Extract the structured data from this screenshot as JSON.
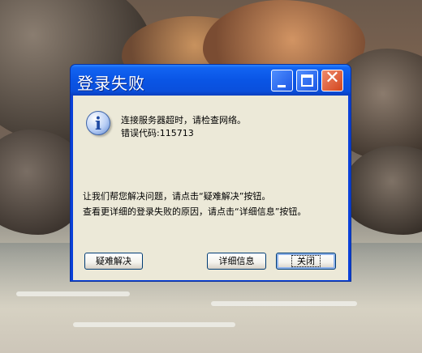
{
  "dialog": {
    "title": "登录失败",
    "message_line1": "连接服务器超时，请检查网络。",
    "message_line2": "错误代码:115713",
    "help_line1": "让我们帮您解决问题，请点击“疑难解决”按钮。",
    "help_line2": "查看更详细的登录失败的原因，请点击“详细信息”按钮。",
    "icon": "info-icon",
    "buttons": {
      "troubleshoot": "疑难解决",
      "details": "详细信息",
      "close": "关闭"
    },
    "controls": {
      "close_glyph": "✕"
    }
  },
  "colors": {
    "titlebar": "#0a55e5",
    "client_background": "#ece9d8",
    "close_button": "#d3461e"
  }
}
